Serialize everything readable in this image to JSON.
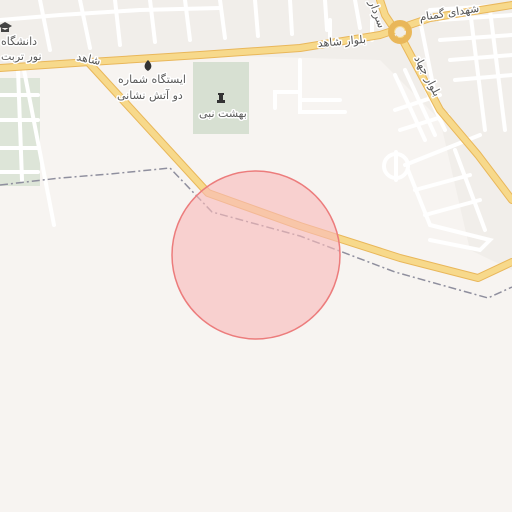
{
  "map": {
    "labels": {
      "boulevard_shahed": "بلوار شاهد",
      "shahed_left": "شاهد",
      "shohada_kamnam": "شهدای گمنام",
      "sardar": "سردار",
      "boulevard_jahad": "بلوار جهاد",
      "university": "دانشگاه",
      "noor_torbat": "نور تربت",
      "fire_station_line1": "ایستگاه شماره",
      "fire_station_line2": "دو آتش نشانی",
      "behesht_nabi": "بهشت نبی"
    },
    "icons": {
      "fire_station": "fire-station-icon",
      "cemetery": "cemetery-icon",
      "university": "graduation-cap-icon"
    },
    "colors": {
      "background": "#f7f4f1",
      "major_road": "#f7d98b",
      "major_road_casing": "#e9b75a",
      "minor_road": "#ffffff",
      "boundary": "#8f8f9e",
      "green_area": "#dde5d8",
      "accuracy_circle_fill": "#f8b9b9",
      "accuracy_circle_stroke": "#ec7c7c"
    }
  }
}
